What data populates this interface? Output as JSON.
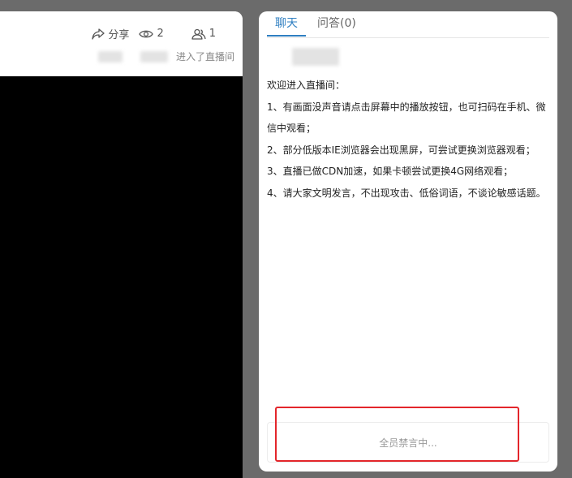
{
  "stats": {
    "share_label": "分享",
    "share_icon": "share-icon",
    "views_count": "2",
    "views_icon": "eye-icon",
    "users_count": "1",
    "users_icon": "users-icon",
    "join_text": "进入了直播间"
  },
  "tabs": {
    "chat_label": "聊天",
    "qa_label": "问答(0)",
    "active": "chat",
    "accent_color": "#2f7fc1"
  },
  "notice": {
    "lines": [
      "欢迎进入直播间：",
      "1、有画面没声音请点击屏幕中的播放按钮，也可扫码在手机、微信中观看；",
      "2、部分低版本IE浏览器会出现黑屏，可尝试更换浏览器观看；",
      "3、直播已做CDN加速，如果卡顿尝试更换4G网络观看；",
      "4、请大家文明发言，不出现攻击、低俗词语，不谈论敏感话题。"
    ]
  },
  "chat_input": {
    "muted_text": "全员禁言中..."
  },
  "colors": {
    "background": "#6b6b6b",
    "video": "#000000",
    "highlight": "#e3262b"
  }
}
